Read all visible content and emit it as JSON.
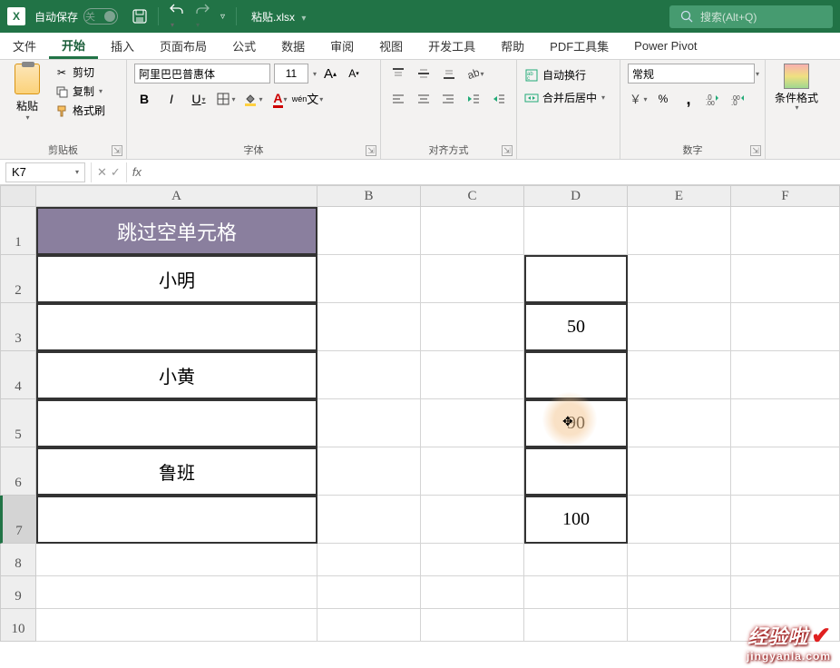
{
  "titlebar": {
    "autosave_label": "自动保存",
    "autosave_state": "关",
    "filename": "粘贴.xlsx",
    "search_placeholder": "搜索(Alt+Q)"
  },
  "tabs": {
    "file": "文件",
    "home": "开始",
    "insert": "插入",
    "layout": "页面布局",
    "formulas": "公式",
    "data": "数据",
    "review": "审阅",
    "view": "视图",
    "dev": "开发工具",
    "help": "帮助",
    "pdf": "PDF工具集",
    "powerpivot": "Power Pivot"
  },
  "ribbon": {
    "clipboard": {
      "paste": "粘贴",
      "cut": "剪切",
      "copy": "复制",
      "format_painter": "格式刷",
      "group": "剪贴板"
    },
    "font": {
      "name": "阿里巴巴普惠体",
      "size": "11",
      "group": "字体",
      "wen": "wén"
    },
    "alignment": {
      "group": "对齐方式",
      "wrap": "自动换行",
      "merge": "合并后居中"
    },
    "number": {
      "format": "常规",
      "group": "数字"
    },
    "styles": {
      "cond_format": "条件格式"
    }
  },
  "namebox": "K7",
  "columns": [
    "A",
    "B",
    "C",
    "D",
    "E",
    "F"
  ],
  "rows": [
    "1",
    "2",
    "3",
    "4",
    "5",
    "6",
    "7",
    "8",
    "9",
    "10"
  ],
  "cells": {
    "A1": "跳过空单元格",
    "A2": "小明",
    "A4": "小黄",
    "A6": "鲁班",
    "D3": "50",
    "D5": "90",
    "D7": "100"
  },
  "watermark": {
    "line1": "经验啦",
    "line2": "jingyanla.com"
  }
}
